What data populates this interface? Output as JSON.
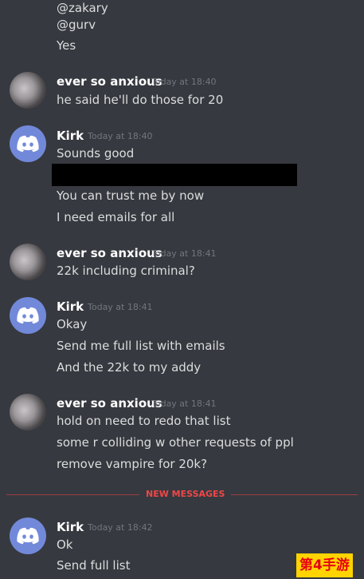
{
  "messages": {
    "top": {
      "line1": "@zakary",
      "line2": "@gurv",
      "line3": "Yes"
    },
    "m1": {
      "author": "ever so anxious",
      "time": "Today at 18:40",
      "lines": [
        "he said he'll do those for 20"
      ]
    },
    "m2": {
      "author": "Kirk",
      "time": "Today at 18:40",
      "lines": [
        "Sounds good",
        "You can trust me by now",
        "I need emails for all"
      ]
    },
    "m3": {
      "author": "ever so anxious",
      "time": "Today at 18:41",
      "lines": [
        "22k including criminal?"
      ]
    },
    "m4": {
      "author": "Kirk",
      "time": "Today at 18:41",
      "lines": [
        "Okay",
        "Send me full list with emails",
        "And the 22k to my addy"
      ]
    },
    "m5": {
      "author": "ever so anxious",
      "time": "Today at 18:41",
      "lines": [
        "hold on need to redo that list",
        "some r colliding w other requests of ppl",
        "remove vampire for 20k?"
      ]
    },
    "divider": "NEW MESSAGES",
    "m6": {
      "author": "Kirk",
      "time": "Today at 18:42",
      "lines": [
        "Ok",
        "Send full list"
      ]
    }
  },
  "watermark": "第4手游",
  "colors": {
    "background": "#36393f",
    "text": "#dcddde",
    "username": "#ffffff",
    "timestamp": "#72767d",
    "new_messages": "#f04747",
    "discord_avatar": "#7289da"
  },
  "icons": {
    "discord_avatar": "discord-logo-icon",
    "user_avatar": "user-photo-avatar"
  }
}
